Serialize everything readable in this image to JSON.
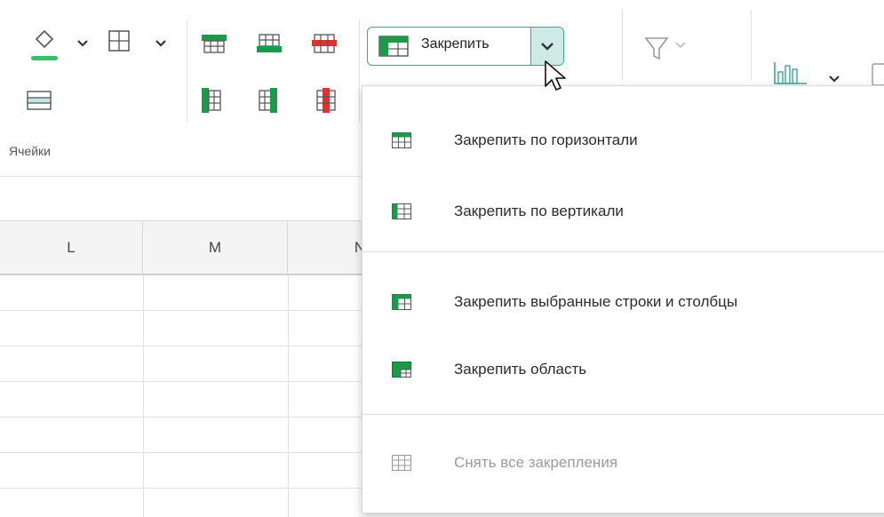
{
  "ribbon": {
    "group_cells_label": "Ячейки",
    "freeze_button_label": "Закрепить",
    "icons": [
      "fill-color-icon",
      "borders-icon",
      "insert-rows-icon",
      "insert-columns-icon",
      "delete-rows-icon",
      "insert-cells-icon",
      "column-left-icon",
      "column-mid-icon",
      "column-delete-icon",
      "filter-icon",
      "chart-icon"
    ]
  },
  "columns": [
    "L",
    "M",
    "N"
  ],
  "freeze_menu": {
    "items": [
      {
        "label": "Закрепить по горизонтали",
        "icon": "freeze-horizontal-icon",
        "enabled": true
      },
      {
        "label": "Закрепить по вертикали",
        "icon": "freeze-vertical-icon",
        "enabled": true
      },
      {
        "label": "Закрепить выбранные строки и столбцы",
        "icon": "freeze-rows-columns-icon",
        "enabled": true
      },
      {
        "label": "Закрепить область",
        "icon": "freeze-area-icon",
        "enabled": true
      },
      {
        "label": "Снять все закрепления",
        "icon": "unfreeze-icon",
        "enabled": false
      }
    ]
  },
  "colors": {
    "accent": "#3aa699",
    "icon_green": "#1a9b4a",
    "icon_dark_green": "#0f7a37",
    "icon_red": "#e03131",
    "disabled_text": "#9a9a9a"
  }
}
